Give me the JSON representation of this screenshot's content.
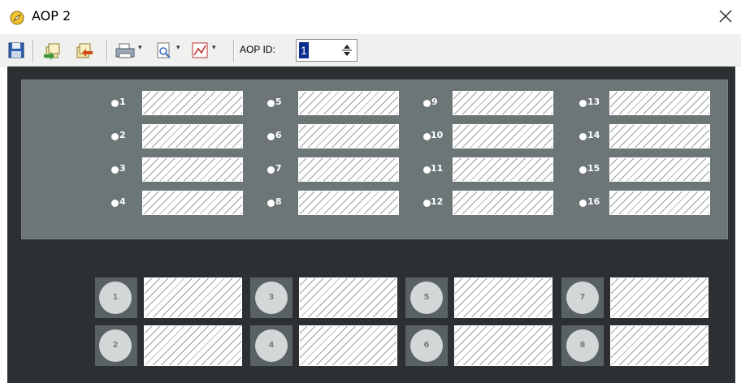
{
  "window": {
    "title": "AOP 2",
    "icon": "compass-icon",
    "close_icon": "close-icon"
  },
  "toolbar": {
    "buttons": [
      "save-icon",
      "import-icon",
      "export-icon",
      "print-icon",
      "print-preview-icon",
      "report-icon"
    ],
    "aop_id_label": "AOP ID:",
    "aop_id_value": "1"
  },
  "leds": [
    "1",
    "2",
    "3",
    "4",
    "5",
    "6",
    "7",
    "8",
    "9",
    "10",
    "11",
    "12",
    "13",
    "14",
    "15",
    "16"
  ],
  "pushbuttons": [
    "1",
    "2",
    "3",
    "4",
    "5",
    "6",
    "7",
    "8"
  ],
  "colors": {
    "panel_dark": "#2c3032",
    "panel_upper": "#6d7676",
    "pad_bg": "#596263",
    "selection": "#0b2d8c"
  }
}
